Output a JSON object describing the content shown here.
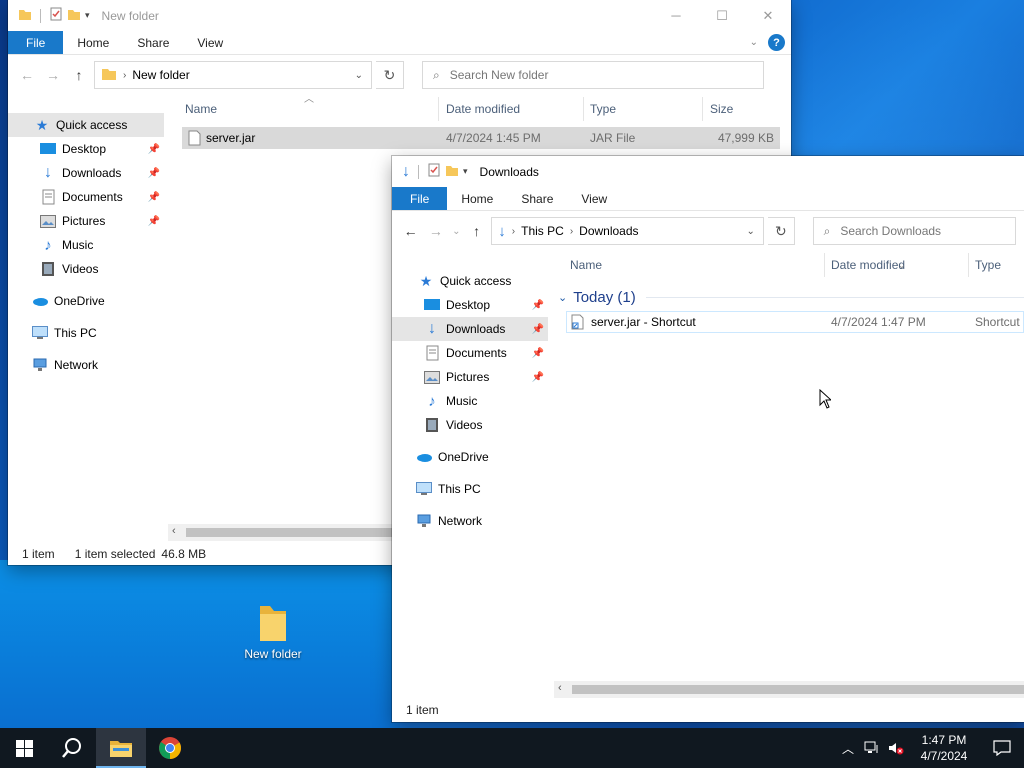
{
  "colors": {
    "accent": "#1979ca",
    "folder": "#f6c75a",
    "taskbar": "#101820",
    "selection": "#cce8ff"
  },
  "window1": {
    "title": "New folder",
    "ribbon": {
      "file": "File",
      "home": "Home",
      "share": "Share",
      "view": "View"
    },
    "address": {
      "segment": "New folder"
    },
    "search_placeholder": "Search New folder",
    "nav": {
      "quick_access": "Quick access",
      "items": [
        {
          "label": "Desktop",
          "pinned": true
        },
        {
          "label": "Downloads",
          "pinned": true
        },
        {
          "label": "Documents",
          "pinned": true
        },
        {
          "label": "Pictures",
          "pinned": true
        },
        {
          "label": "Music",
          "pinned": false
        },
        {
          "label": "Videos",
          "pinned": false
        }
      ],
      "onedrive": "OneDrive",
      "this_pc": "This PC",
      "network": "Network"
    },
    "columns": {
      "name": "Name",
      "date": "Date modified",
      "type": "Type",
      "size": "Size"
    },
    "files": [
      {
        "name": "server.jar",
        "date": "4/7/2024 1:45 PM",
        "type": "JAR File",
        "size": "47,999 KB",
        "selected": true
      }
    ],
    "status": {
      "count": "1 item",
      "selection": "1 item selected",
      "size": "46.8 MB"
    }
  },
  "window2": {
    "title": "Downloads",
    "ribbon": {
      "file": "File",
      "home": "Home",
      "share": "Share",
      "view": "View"
    },
    "address": {
      "segment1": "This PC",
      "segment2": "Downloads"
    },
    "search_placeholder": "Search Downloads",
    "nav": {
      "quick_access": "Quick access",
      "items": [
        {
          "label": "Desktop",
          "pinned": true
        },
        {
          "label": "Downloads",
          "pinned": true
        },
        {
          "label": "Documents",
          "pinned": true
        },
        {
          "label": "Pictures",
          "pinned": true
        },
        {
          "label": "Music",
          "pinned": false
        },
        {
          "label": "Videos",
          "pinned": false
        }
      ],
      "onedrive": "OneDrive",
      "this_pc": "This PC",
      "network": "Network"
    },
    "columns": {
      "name": "Name",
      "date": "Date modified",
      "type": "Type"
    },
    "group": "Today (1)",
    "files": [
      {
        "name": "server.jar - Shortcut",
        "date": "4/7/2024 1:47 PM",
        "type": "Shortcut"
      }
    ],
    "status": {
      "count": "1 item"
    }
  },
  "desktop": {
    "icon_label": "New folder"
  },
  "taskbar": {
    "time": "1:47 PM",
    "date": "4/7/2024"
  }
}
